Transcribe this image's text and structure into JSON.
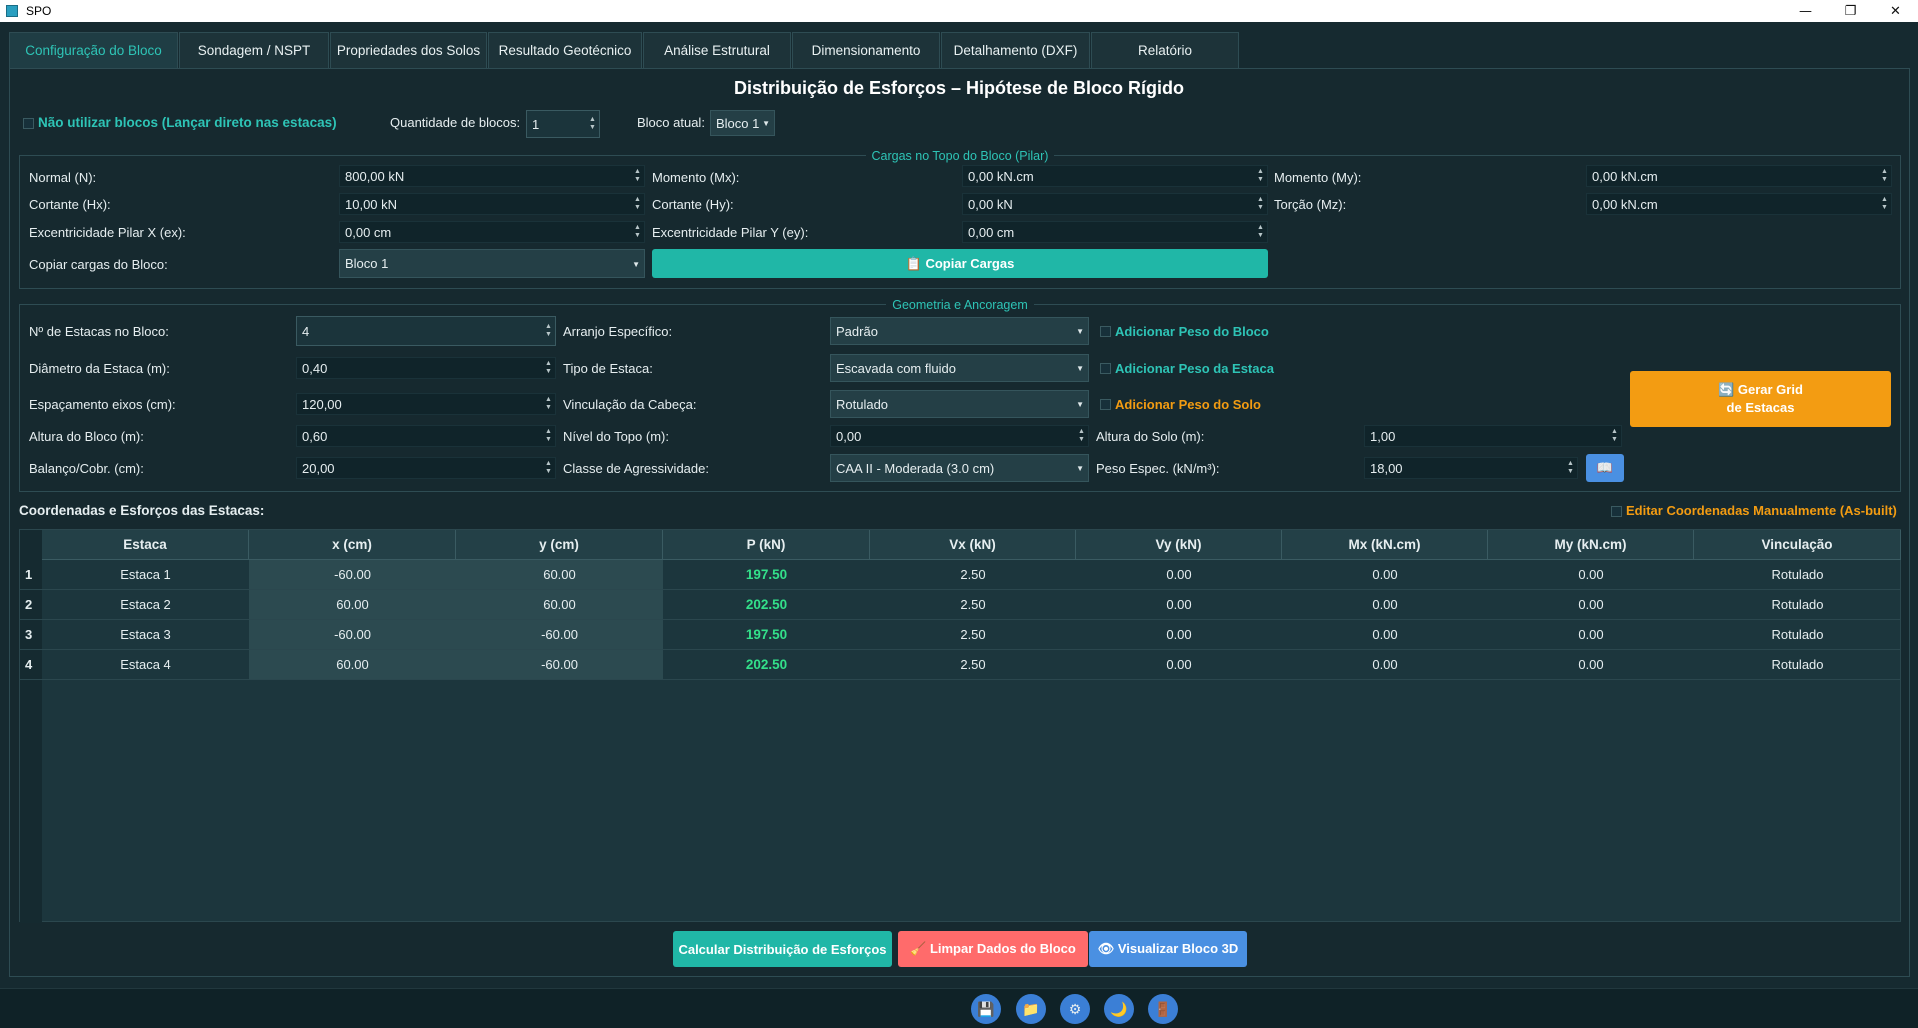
{
  "window": {
    "title": "SPO",
    "minimize": "—",
    "restore": "❐",
    "close": "✕"
  },
  "tabs": [
    {
      "label": "Configuração do Bloco"
    },
    {
      "label": "Sondagem / NSPT"
    },
    {
      "label": "Propriedades dos Solos"
    },
    {
      "label": "Resultado Geotécnico"
    },
    {
      "label": "Análise Estrutural"
    },
    {
      "label": "Dimensionamento"
    },
    {
      "label": "Detalhamento (DXF)"
    },
    {
      "label": "Relatório"
    }
  ],
  "heading": "Distribuição de Esforços – Hipótese de Bloco Rígido",
  "topbar": {
    "no_blocks_label": "Não utilizar blocos (Lançar direto nas estacas)",
    "qty_label": "Quantidade de blocos:",
    "qty_value": "1",
    "current_label": "Bloco atual:",
    "current_value": "Bloco 1"
  },
  "loads": {
    "title": "Cargas no Topo do Bloco (Pilar)",
    "normal_label": "Normal (N):",
    "normal_value": "800,00 kN",
    "mx_label": "Momento (Mx):",
    "mx_value": "0,00 kN.cm",
    "my_label": "Momento (My):",
    "my_value": "0,00 kN.cm",
    "hx_label": "Cortante (Hx):",
    "hx_value": "10,00 kN",
    "hy_label": "Cortante (Hy):",
    "hy_value": "0,00 kN",
    "mz_label": "Torção (Mz):",
    "mz_value": "0,00 kN.cm",
    "ex_label": "Excentricidade Pilar X (ex):",
    "ex_value": "0,00 cm",
    "ey_label": "Excentricidade Pilar Y (ey):",
    "ey_value": "0,00 cm",
    "copy_label": "Copiar cargas do Bloco:",
    "copy_value": "Bloco 1",
    "copy_button": "📋 Copiar Cargas"
  },
  "geometry": {
    "title": "Geometria e Ancoragem",
    "n_label": "Nº de Estacas no Bloco:",
    "n_value": "4",
    "diam_label": "Diâmetro da Estaca (m):",
    "diam_value": "0,40",
    "esp_label": "Espaçamento eixos (cm):",
    "esp_value": "120,00",
    "h_label": "Altura do Bloco (m):",
    "h_value": "0,60",
    "bal_label": "Balanço/Cobr. (cm):",
    "bal_value": "20,00",
    "arr_label": "Arranjo Específico:",
    "arr_value": "Padrão",
    "tipo_label": "Tipo de Estaca:",
    "tipo_value": "Escavada com fluido",
    "vinc_label": "Vinculação da Cabeça:",
    "vinc_value": "Rotulado",
    "nivel_label": "Nível do Topo (m):",
    "nivel_value": "0,00",
    "classe_label": "Classe de Agressividade:",
    "classe_value": "CAA II - Moderada (3.0 cm)",
    "peso_bloco_label": "Adicionar Peso do Bloco",
    "peso_estaca_label": "Adicionar Peso da Estaca",
    "peso_solo_label": "Adicionar Peso do Solo",
    "alt_solo_label": "Altura do Solo (m):",
    "alt_solo_value": "1,00",
    "peso_espec_label": "Peso Espec. (kN/m³):",
    "peso_espec_value": "18,00",
    "grid_button_l1": "🔄 Gerar Grid",
    "grid_button_l2": "de Estacas",
    "book_icon": "📖"
  },
  "table": {
    "title": "Coordenadas e Esforços das Estacas:",
    "edit_label": "Editar Coordenadas Manualmente (As-built)",
    "columns": [
      "Estaca",
      "x (cm)",
      "y (cm)",
      "P (kN)",
      "Vx (kN)",
      "Vy (kN)",
      "Mx (kN.cm)",
      "My (kN.cm)",
      "Vinculação"
    ],
    "rows": [
      {
        "n": "1",
        "cells": [
          "Estaca 1",
          "-60.00",
          "60.00",
          "197.50",
          "2.50",
          "0.00",
          "0.00",
          "0.00",
          "Rotulado"
        ]
      },
      {
        "n": "2",
        "cells": [
          "Estaca 2",
          "60.00",
          "60.00",
          "202.50",
          "2.50",
          "0.00",
          "0.00",
          "0.00",
          "Rotulado"
        ]
      },
      {
        "n": "3",
        "cells": [
          "Estaca 3",
          "-60.00",
          "-60.00",
          "197.50",
          "2.50",
          "0.00",
          "0.00",
          "0.00",
          "Rotulado"
        ]
      },
      {
        "n": "4",
        "cells": [
          "Estaca 4",
          "60.00",
          "-60.00",
          "202.50",
          "2.50",
          "0.00",
          "0.00",
          "0.00",
          "Rotulado"
        ]
      }
    ]
  },
  "actions": {
    "calc": "Calcular Distribuição de Esforços",
    "clear": "🧹 Limpar Dados do Bloco",
    "view3d": "👁 Visualizar Bloco 3D"
  },
  "bottom_icons": [
    "💾",
    "📁",
    "⚙",
    "🌙",
    "🚪"
  ],
  "colors": {
    "accent": "#2ec4b6",
    "orange": "#f39c12",
    "red": "#ff6b6b",
    "blue": "#4a90e2",
    "pvalue": "#33e08a"
  }
}
